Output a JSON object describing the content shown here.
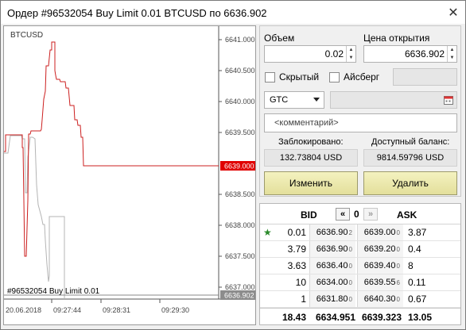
{
  "window": {
    "title": "Ордер #96532054 Buy Limit 0.01 BTCUSD по 6636.902",
    "close_label": "✕"
  },
  "chart": {
    "symbol": "BTCUSD",
    "order_label": "#96532054 Buy Limit 0.01",
    "current_price_label": "6639.000",
    "order_price_label": "6636.902",
    "y_ticks": [
      "6641.000",
      "6640.500",
      "6640.000",
      "6639.500",
      "6638.500",
      "6638.000",
      "6637.500",
      "6637.000"
    ],
    "x_ticks": [
      "20.06.2018",
      "09:27:44",
      "09:28:31",
      "09:29:30"
    ],
    "colors": {
      "line": "#cc1f1f",
      "shadow": "#b4b4b4",
      "price_tag": "#e00000",
      "order_tag": "#8c8c8c"
    }
  },
  "form": {
    "volume_label": "Объем",
    "volume_value": "0.02",
    "open_price_label": "Цена открытия",
    "open_price_value": "6636.902",
    "hidden_label": "Скрытый",
    "iceberg_label": "Айсберг",
    "expiry_value": "GTC",
    "comment_placeholder": "<комментарий>",
    "blocked_label": "Заблокировано:",
    "blocked_value": "132.73804 USD",
    "available_label": "Доступный баланс:",
    "available_value": "9814.59796 USD",
    "modify_label": "Изменить",
    "delete_label": "Удалить"
  },
  "book": {
    "bid_header": "BID",
    "ask_header": "ASK",
    "depth": "0",
    "nav_left": "«",
    "nav_right": "»",
    "rows": [
      {
        "star": "★",
        "bid_vol": "0.01",
        "bid_main": "6636.90",
        "bid_sup": "2",
        "ask_main": "6639.00",
        "ask_sup": "0",
        "ask_vol": "3.87"
      },
      {
        "star": "",
        "bid_vol": "3.79",
        "bid_main": "6636.90",
        "bid_sup": "0",
        "ask_main": "6639.20",
        "ask_sup": "0",
        "ask_vol": "0.4"
      },
      {
        "star": "",
        "bid_vol": "3.63",
        "bid_main": "6636.40",
        "bid_sup": "0",
        "ask_main": "6639.40",
        "ask_sup": "0",
        "ask_vol": "8"
      },
      {
        "star": "",
        "bid_vol": "10",
        "bid_main": "6634.00",
        "bid_sup": "0",
        "ask_main": "6639.55",
        "ask_sup": "6",
        "ask_vol": "0.11"
      },
      {
        "star": "",
        "bid_vol": "1",
        "bid_main": "6631.80",
        "bid_sup": "0",
        "ask_main": "6640.30",
        "ask_sup": "0",
        "ask_vol": "0.67"
      }
    ],
    "totals": {
      "bid_vol": "18.43",
      "bid_price": "6634.951",
      "ask_price": "6639.323",
      "ask_vol": "13.05"
    }
  }
}
